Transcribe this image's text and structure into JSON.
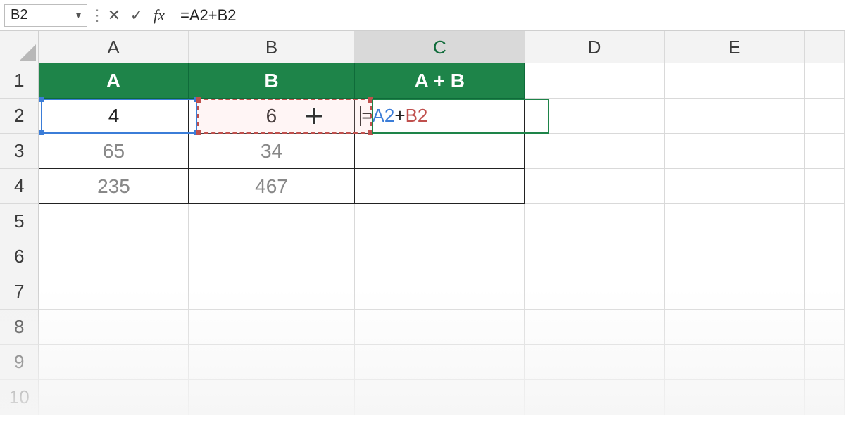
{
  "formula_bar": {
    "name_box": "B2",
    "cancel_icon": "✕",
    "enter_icon": "✓",
    "fx_label": "fx",
    "formula_text": "=A2+B2"
  },
  "columns": {
    "A": "A",
    "B": "B",
    "C": "C",
    "D": "D",
    "E": "E"
  },
  "rows": {
    "r1": "1",
    "r2": "2",
    "r3": "3",
    "r4": "4",
    "r5": "5",
    "r6": "6",
    "r7": "7",
    "r8": "8",
    "r9": "9",
    "r10": "10"
  },
  "table": {
    "headers": {
      "a": "A",
      "b": "B",
      "c": "A + B"
    },
    "data": [
      {
        "a": "4",
        "b": "6",
        "c_formula": {
          "eq": "=",
          "ref1": "A2",
          "op": "+",
          "ref2": "B2"
        }
      },
      {
        "a": "65",
        "b": "34",
        "c": ""
      },
      {
        "a": "235",
        "b": "467",
        "c": ""
      }
    ]
  },
  "chart_data": {
    "type": "table",
    "title": "",
    "columns": [
      "A",
      "B",
      "A + B"
    ],
    "rows": [
      [
        4,
        6,
        "=A2+B2"
      ],
      [
        65,
        34,
        null
      ],
      [
        235,
        467,
        null
      ]
    ]
  }
}
